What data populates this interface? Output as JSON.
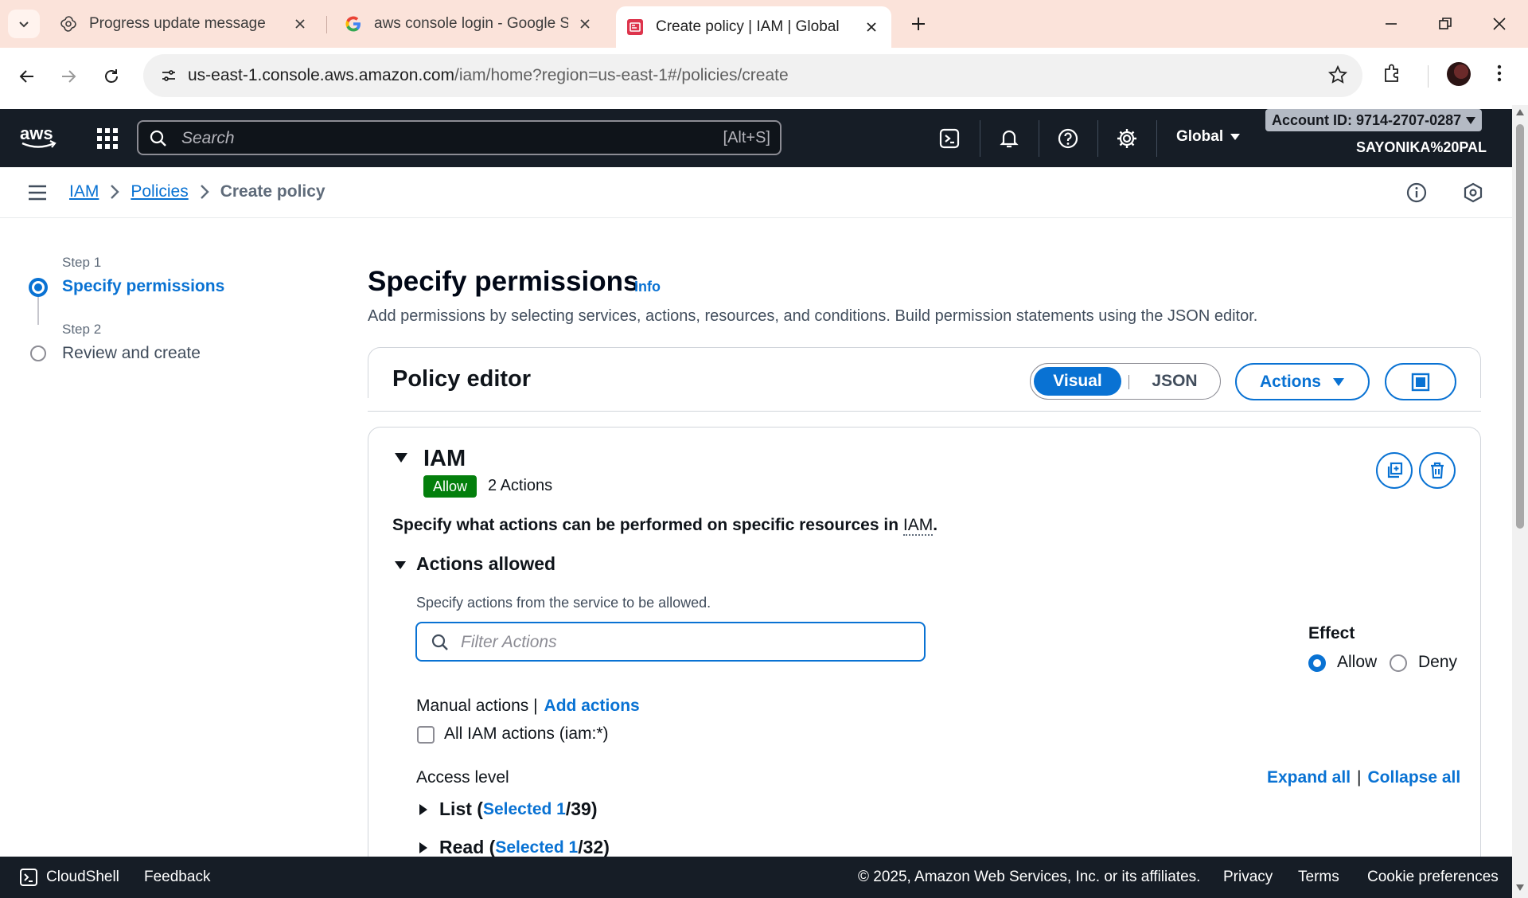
{
  "browser": {
    "tabs": [
      {
        "title": "Progress update message",
        "icon": "openai-icon"
      },
      {
        "title": "aws console login - Google Sea",
        "icon": "google-icon"
      },
      {
        "title": "Create policy | IAM | Global",
        "icon": "aws-iam-icon"
      }
    ],
    "url_domain": "us-east-1.console.aws.amazon.com",
    "url_path": "/iam/home?region=us-east-1#/policies/create"
  },
  "aws_header": {
    "search_placeholder": "Search",
    "search_shortcut": "[Alt+S]",
    "region": "Global",
    "account": "Account ID: 9714-2707-0287",
    "user": "SAYONIKA%20PAL"
  },
  "breadcrumb": {
    "items": [
      "IAM",
      "Policies"
    ],
    "current": "Create policy"
  },
  "stepper": {
    "steps": [
      {
        "caption": "Step 1",
        "title": "Specify permissions"
      },
      {
        "caption": "Step 2",
        "title": "Review and create"
      }
    ]
  },
  "main": {
    "title": "Specify permissions",
    "info": "Info",
    "description": "Add permissions by selecting services, actions, resources, and conditions. Build permission statements using the JSON editor."
  },
  "editor": {
    "title": "Policy editor",
    "mode_visual": "Visual",
    "mode_json": "JSON",
    "actions_label": "Actions"
  },
  "statement": {
    "service": "IAM",
    "effect_badge": "Allow",
    "actions_count": "2 Actions",
    "desc_prefix": "Specify what actions can be performed on specific resources in ",
    "desc_service": "IAM",
    "desc_suffix": "."
  },
  "actions_allowed": {
    "title": "Actions allowed",
    "hint": "Specify actions from the service to be allowed.",
    "filter_placeholder": "Filter Actions",
    "effect_label": "Effect",
    "effect_allow": "Allow",
    "effect_deny": "Deny",
    "manual_label": "Manual actions |",
    "add_actions": "Add actions",
    "all_actions_label": "All IAM actions (iam:*)",
    "access_level_label": "Access level",
    "expand_all": "Expand all",
    "separator": "|",
    "collapse_all": "Collapse all",
    "levels": [
      {
        "name": "List",
        "selected_label": "Selected 1",
        "total": "/39"
      },
      {
        "name": "Read",
        "selected_label": "Selected 1",
        "total": "/32"
      }
    ]
  },
  "footer": {
    "cloudshell": "CloudShell",
    "feedback": "Feedback",
    "copyright": "© 2025, Amazon Web Services, Inc. or its affiliates.",
    "privacy": "Privacy",
    "terms": "Terms",
    "cookies": "Cookie preferences"
  },
  "colors": {
    "aws_header": "#161d26",
    "link_blue": "#0972d3",
    "allow_green": "#037f0c",
    "tabstrip": "#fbe3da"
  }
}
